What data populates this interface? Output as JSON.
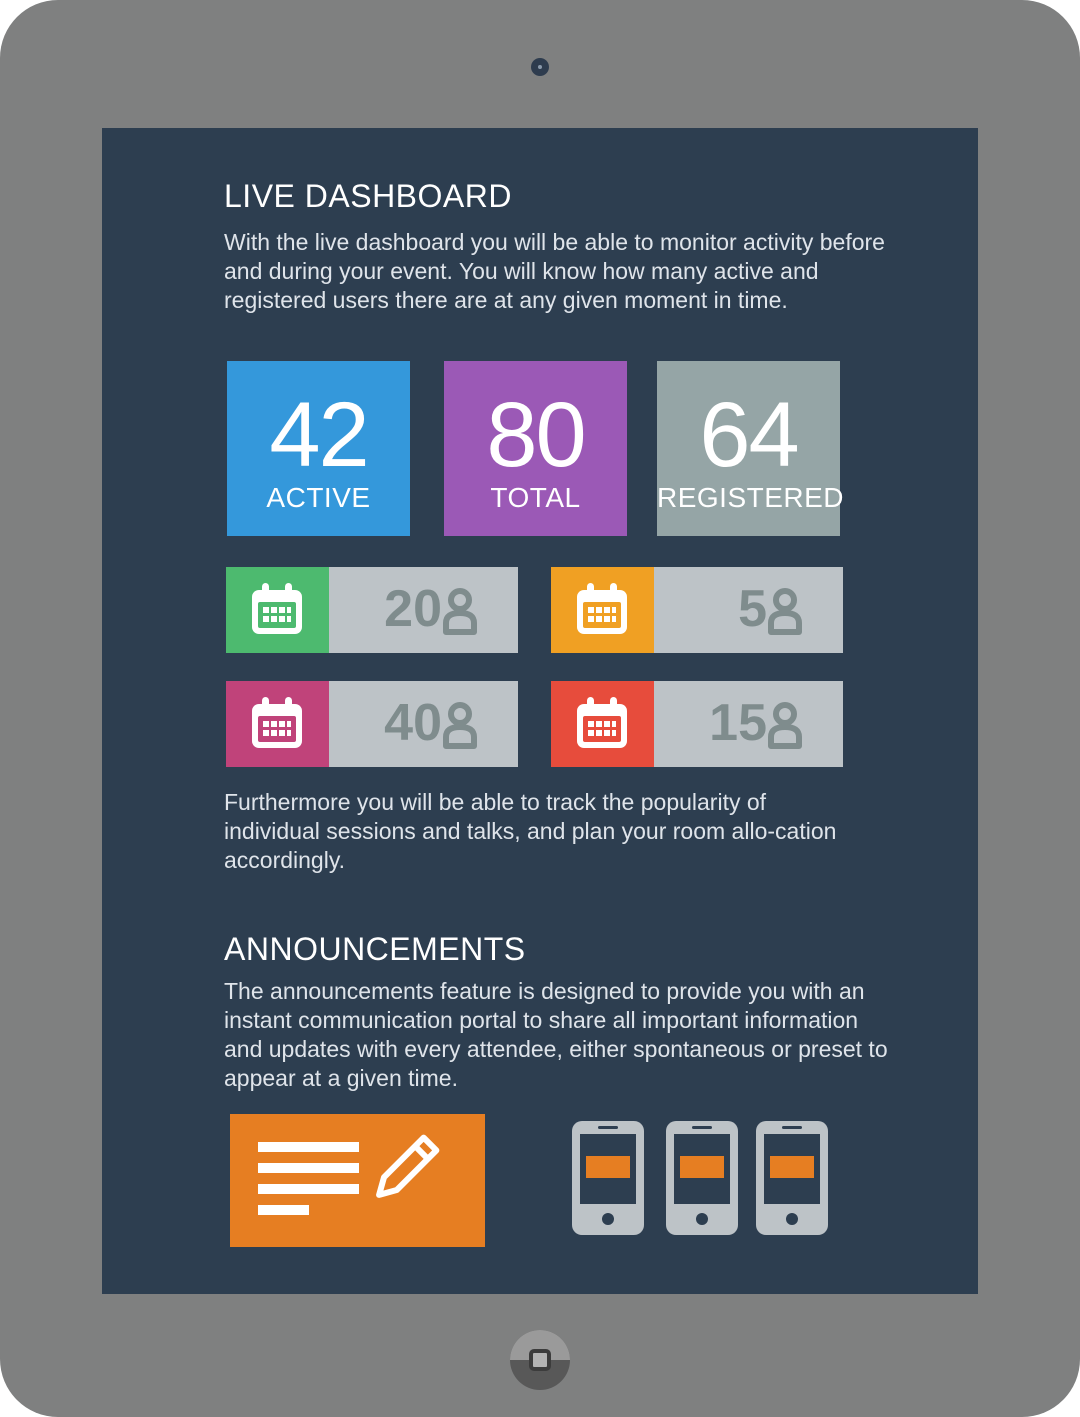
{
  "live_dashboard": {
    "title": "LIVE DASHBOARD",
    "description": "With the live dashboard you will be able to monitor activity before and during your event. You will know how many active and registered users there are at any given moment in time."
  },
  "stats": [
    {
      "value": "42",
      "label": "ACTIVE",
      "color": "#3498db"
    },
    {
      "value": "80",
      "label": "TOTAL",
      "color": "#9b59b6"
    },
    {
      "value": "64",
      "label": "REGISTERED",
      "color": "#95a5a6"
    }
  ],
  "sessions": [
    {
      "count": "20",
      "color": "#4dba6f",
      "icon": "calendar-icon"
    },
    {
      "count": "5",
      "color": "#f0a023",
      "icon": "calendar-icon"
    },
    {
      "count": "40",
      "color": "#c0437a",
      "icon": "calendar-icon"
    },
    {
      "count": "15",
      "color": "#e74c3c",
      "icon": "calendar-icon"
    }
  ],
  "tracking_text": "Furthermore you will be able to track the popularity of individual sessions and talks, and plan your room allo-cation accordingly.",
  "announcements": {
    "title": "ANNOUNCEMENTS",
    "description": "The announcements feature is designed to provide you with an instant communication portal to share all important information and updates with every attendee, either spontaneous or preset to appear at a given time.",
    "accent_color": "#e67e22",
    "icons": [
      "document-edit-icon",
      "phone-icon",
      "phone-icon",
      "phone-icon"
    ]
  }
}
